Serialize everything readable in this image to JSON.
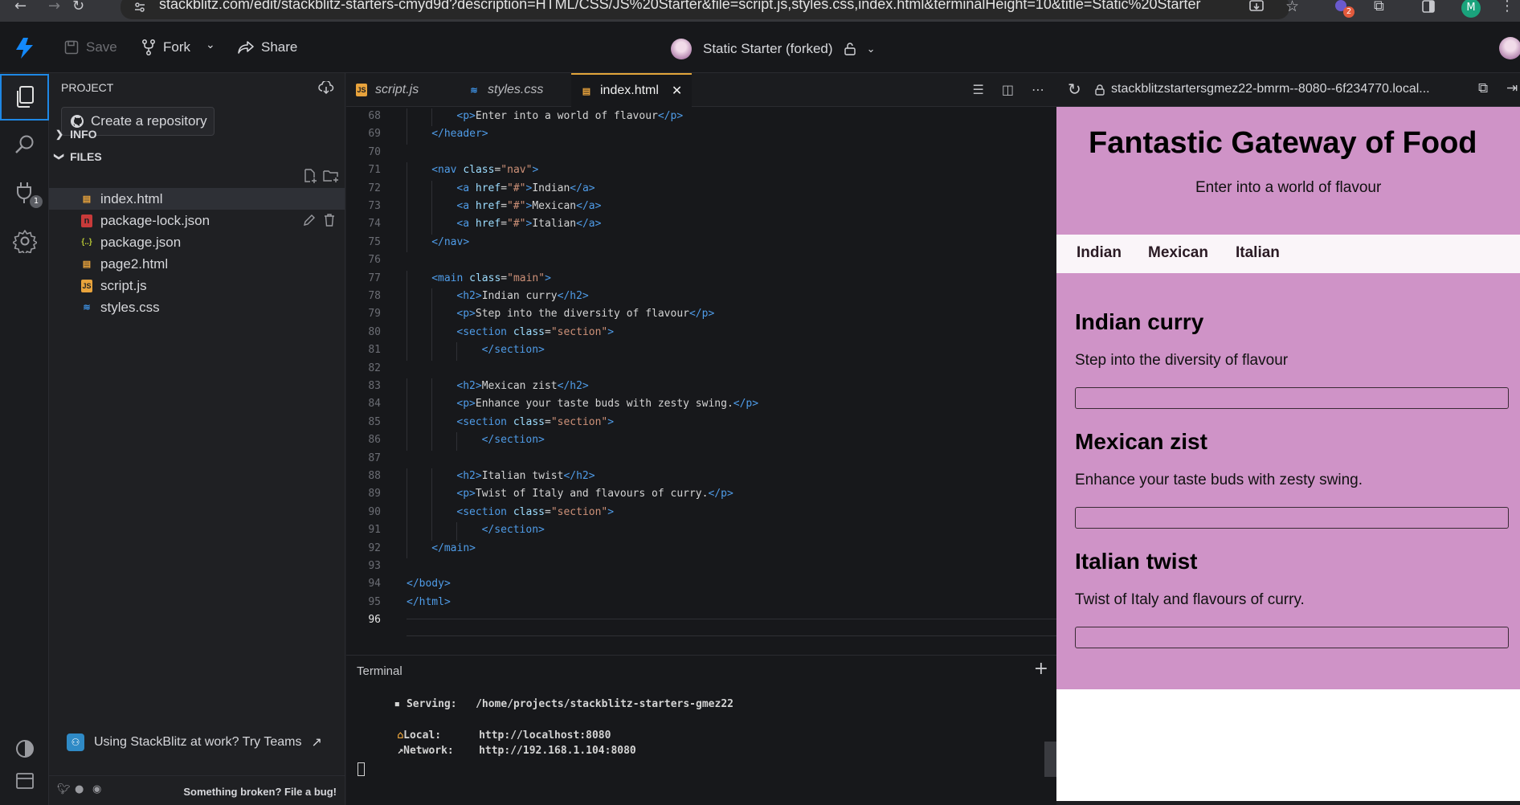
{
  "browser": {
    "url": "stackblitz.com/edit/stackblitz-starters-cmyd9d?description=HTML/CSS/JS%20Starter&file=script.js,styles.css,index.html&terminalHeight=10&title=Static%20Starter",
    "extensions_badge": "2",
    "profile_initial": "M"
  },
  "toolbar": {
    "save_label": "Save",
    "fork_label": "Fork",
    "share_label": "Share",
    "project_title": "Static Starter (forked)"
  },
  "activity": {
    "ports_badge": "1"
  },
  "sidebar": {
    "title": "PROJECT",
    "create_repo_label": "Create a repository",
    "info_label": "INFO",
    "files_label": "FILES",
    "files": [
      {
        "name": "index.html",
        "type": "html"
      },
      {
        "name": "package-lock.json",
        "type": "npm"
      },
      {
        "name": "package.json",
        "type": "json"
      },
      {
        "name": "page2.html",
        "type": "html"
      },
      {
        "name": "script.js",
        "type": "js"
      },
      {
        "name": "styles.css",
        "type": "css"
      }
    ],
    "teams_label": "Using StackBlitz at work? Try Teams",
    "bug_label": "Something broken? File a bug!"
  },
  "tabs": [
    {
      "label": "script.js",
      "icon": "js"
    },
    {
      "label": "styles.css",
      "icon": "css"
    },
    {
      "label": "index.html",
      "icon": "html"
    }
  ],
  "editor": {
    "lines": [
      {
        "n": "68",
        "indent": 2,
        "parts": [
          [
            "tg",
            "<"
          ],
          [
            "tg",
            "p"
          ],
          [
            "tg",
            ">"
          ],
          [
            "tx",
            "Enter into a world of flavour"
          ],
          [
            "tg",
            "</p>"
          ]
        ]
      },
      {
        "n": "69",
        "indent": 1,
        "parts": [
          [
            "tg",
            "</header>"
          ]
        ]
      },
      {
        "n": "70",
        "indent": 0,
        "parts": []
      },
      {
        "n": "71",
        "indent": 1,
        "parts": [
          [
            "tg",
            "<nav "
          ],
          [
            "at",
            "class"
          ],
          [
            "tx",
            "="
          ],
          [
            "st",
            "\"nav\""
          ],
          [
            "tg",
            ">"
          ]
        ]
      },
      {
        "n": "72",
        "indent": 2,
        "parts": [
          [
            "tg",
            "<a "
          ],
          [
            "at",
            "href"
          ],
          [
            "tx",
            "="
          ],
          [
            "st",
            "\"#\""
          ],
          [
            "tg",
            ">"
          ],
          [
            "tx",
            "Indian"
          ],
          [
            "tg",
            "</a>"
          ]
        ]
      },
      {
        "n": "73",
        "indent": 2,
        "parts": [
          [
            "tg",
            "<a "
          ],
          [
            "at",
            "href"
          ],
          [
            "tx",
            "="
          ],
          [
            "st",
            "\"#\""
          ],
          [
            "tg",
            ">"
          ],
          [
            "tx",
            "Mexican"
          ],
          [
            "tg",
            "</a>"
          ]
        ]
      },
      {
        "n": "74",
        "indent": 2,
        "parts": [
          [
            "tg",
            "<a "
          ],
          [
            "at",
            "href"
          ],
          [
            "tx",
            "="
          ],
          [
            "st",
            "\"#\""
          ],
          [
            "tg",
            ">"
          ],
          [
            "tx",
            "Italian"
          ],
          [
            "tg",
            "</a>"
          ]
        ]
      },
      {
        "n": "75",
        "indent": 1,
        "parts": [
          [
            "tg",
            "</nav>"
          ]
        ]
      },
      {
        "n": "76",
        "indent": 0,
        "parts": []
      },
      {
        "n": "77",
        "indent": 1,
        "parts": [
          [
            "tg",
            "<main "
          ],
          [
            "at",
            "class"
          ],
          [
            "tx",
            "="
          ],
          [
            "st",
            "\"main\""
          ],
          [
            "tg",
            ">"
          ]
        ]
      },
      {
        "n": "78",
        "indent": 2,
        "parts": [
          [
            "tg",
            "<h2>"
          ],
          [
            "tx",
            "Indian curry"
          ],
          [
            "tg",
            "</h2>"
          ]
        ]
      },
      {
        "n": "79",
        "indent": 2,
        "parts": [
          [
            "tg",
            "<p>"
          ],
          [
            "tx",
            "Step into the diversity of flavour"
          ],
          [
            "tg",
            "</p>"
          ]
        ]
      },
      {
        "n": "80",
        "indent": 2,
        "parts": [
          [
            "tg",
            "<section "
          ],
          [
            "at",
            "class"
          ],
          [
            "tx",
            "="
          ],
          [
            "st",
            "\"section\""
          ],
          [
            "tg",
            ">"
          ]
        ]
      },
      {
        "n": "81",
        "indent": 3,
        "parts": [
          [
            "tg",
            "</section>"
          ]
        ]
      },
      {
        "n": "82",
        "indent": 0,
        "parts": []
      },
      {
        "n": "83",
        "indent": 2,
        "parts": [
          [
            "tg",
            "<h2>"
          ],
          [
            "tx",
            "Mexican zist"
          ],
          [
            "tg",
            "</h2>"
          ]
        ]
      },
      {
        "n": "84",
        "indent": 2,
        "parts": [
          [
            "tg",
            "<p>"
          ],
          [
            "tx",
            "Enhance your taste buds with zesty swing."
          ],
          [
            "tg",
            "</p>"
          ]
        ]
      },
      {
        "n": "85",
        "indent": 2,
        "parts": [
          [
            "tg",
            "<section "
          ],
          [
            "at",
            "class"
          ],
          [
            "tx",
            "="
          ],
          [
            "st",
            "\"section\""
          ],
          [
            "tg",
            ">"
          ]
        ]
      },
      {
        "n": "86",
        "indent": 3,
        "parts": [
          [
            "tg",
            "</section>"
          ]
        ]
      },
      {
        "n": "87",
        "indent": 0,
        "parts": []
      },
      {
        "n": "88",
        "indent": 2,
        "parts": [
          [
            "tg",
            "<h2>"
          ],
          [
            "tx",
            "Italian twist"
          ],
          [
            "tg",
            "</h2>"
          ]
        ]
      },
      {
        "n": "89",
        "indent": 2,
        "parts": [
          [
            "tg",
            "<p>"
          ],
          [
            "tx",
            "Twist of Italy and flavours of curry."
          ],
          [
            "tg",
            "</p>"
          ]
        ]
      },
      {
        "n": "90",
        "indent": 2,
        "parts": [
          [
            "tg",
            "<section "
          ],
          [
            "at",
            "class"
          ],
          [
            "tx",
            "="
          ],
          [
            "st",
            "\"section\""
          ],
          [
            "tg",
            ">"
          ]
        ]
      },
      {
        "n": "91",
        "indent": 3,
        "parts": [
          [
            "tg",
            "</section>"
          ]
        ]
      },
      {
        "n": "92",
        "indent": 1,
        "parts": [
          [
            "tg",
            "</main>"
          ]
        ]
      },
      {
        "n": "93",
        "indent": 0,
        "parts": []
      },
      {
        "n": "94",
        "indent": 0,
        "parts": [
          [
            "tg",
            "</body>"
          ]
        ]
      },
      {
        "n": "95",
        "indent": 0,
        "parts": [
          [
            "tg",
            "</html>"
          ]
        ]
      },
      {
        "n": "96",
        "indent": 0,
        "parts": []
      }
    ]
  },
  "terminal": {
    "title": "Terminal",
    "serving_label": "Serving:",
    "serving_path": "/home/projects/stackblitz-starters-gmez22",
    "local_label": "Local:",
    "local_url": "http://localhost:8080",
    "network_label": "Network:",
    "network_url": "http://192.168.1.104:8080"
  },
  "preview": {
    "url": "stackblitzstartersgmez22-bmrm--8080--6f234770.local...",
    "title": "Fantastic Gateway of Food",
    "tagline": "Enter into a world of flavour",
    "nav": [
      "Indian",
      "Mexican",
      "Italian"
    ],
    "sections": [
      {
        "heading": "Indian curry",
        "text": "Step into the diversity of flavour"
      },
      {
        "heading": "Mexican zist",
        "text": "Enhance your taste buds with zesty swing."
      },
      {
        "heading": "Italian twist",
        "text": "Twist of Italy and flavours of curry."
      }
    ]
  },
  "colors": {
    "accent": "#1e88e5",
    "preview_pink": "#cf93c7",
    "tab_active_border": "#e2a53a"
  }
}
